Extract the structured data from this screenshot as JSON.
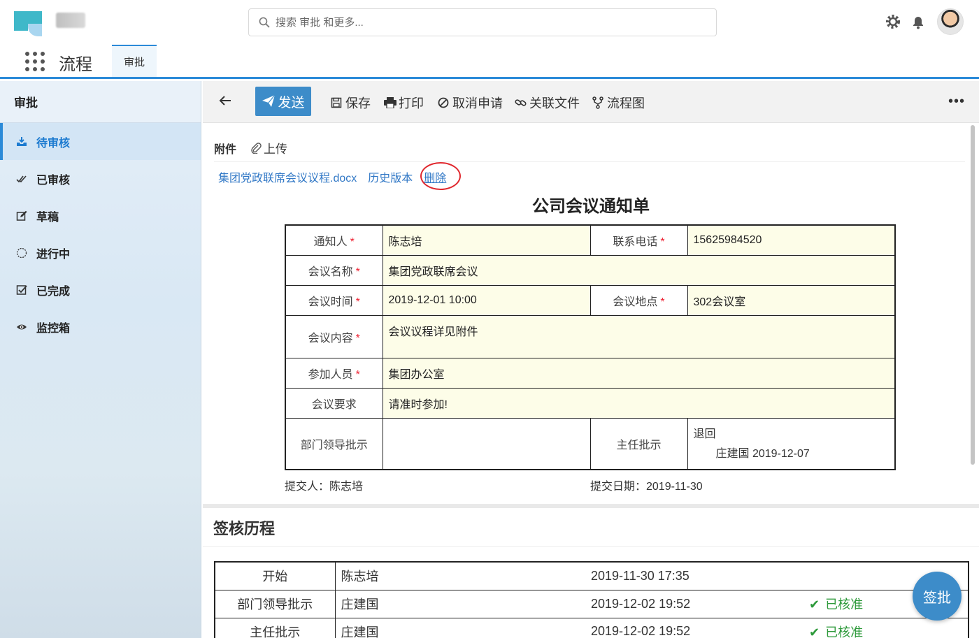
{
  "header": {
    "search_placeholder": "搜索 审批 和更多...",
    "app_title": "流程",
    "app_tab": "审批"
  },
  "sidebar": {
    "title": "审批",
    "items": [
      {
        "label": "待审核",
        "icon": "inbox-download-icon",
        "active": true
      },
      {
        "label": "已审核",
        "icon": "double-check-icon"
      },
      {
        "label": "草稿",
        "icon": "edit-icon"
      },
      {
        "label": "进行中",
        "icon": "spinner-icon"
      },
      {
        "label": "已完成",
        "icon": "checkbox-icon"
      },
      {
        "label": "监控箱",
        "icon": "eye-icon"
      }
    ]
  },
  "toolbar": {
    "send": "发送",
    "save": "保存",
    "print": "打印",
    "cancel": "取消申请",
    "link": "关联文件",
    "flow": "流程图",
    "more": "•••"
  },
  "attachments": {
    "label": "附件",
    "upload": "上传",
    "file_name": "集团党政联席会议议程.docx",
    "history": "历史版本",
    "delete": "删除"
  },
  "form": {
    "title": "公司会议通知单",
    "notifier_label": "通知人",
    "notifier": "陈志培",
    "phone_label": "联系电话",
    "phone": "15625984520",
    "meeting_name_label": "会议名称",
    "meeting_name": "集团党政联席会议",
    "time_label": "会议时间",
    "time": "2019-12-01 10:00",
    "place_label": "会议地点",
    "place": "302会议室",
    "content_label": "会议内容",
    "content": "会议议程详见附件",
    "attendees_label": "参加人员",
    "attendees": "集团办公室",
    "requirement_label": "会议要求",
    "requirement": "请准时参加!",
    "dept_label": "部门领导批示",
    "dept_value": "",
    "director_label": "主任批示",
    "director_action": "退回",
    "director_sign": "庄建国 2019-12-07",
    "submitter": "提交人：陈志培",
    "submit_date": "提交日期：2019-11-30",
    "required_mark": "*"
  },
  "history": {
    "title": "签核历程",
    "rows": [
      {
        "node": "开始",
        "person": "陈志培",
        "time": "2019-11-30 17:35",
        "status": ""
      },
      {
        "node": "部门领导批示",
        "person": "庄建国",
        "time": "2019-12-02 19:52",
        "status": "已核准"
      },
      {
        "node": "主任批示",
        "person": "庄建国",
        "time": "2019-12-02 19:52",
        "status": "已核准"
      }
    ]
  },
  "sign_button": "签批",
  "colors": {
    "accent": "#2b8ad8",
    "button": "#3d8cc9",
    "form_field_bg": "#fdfde8",
    "approved": "#2e9a3b",
    "highlight_circle": "#e0282e"
  }
}
